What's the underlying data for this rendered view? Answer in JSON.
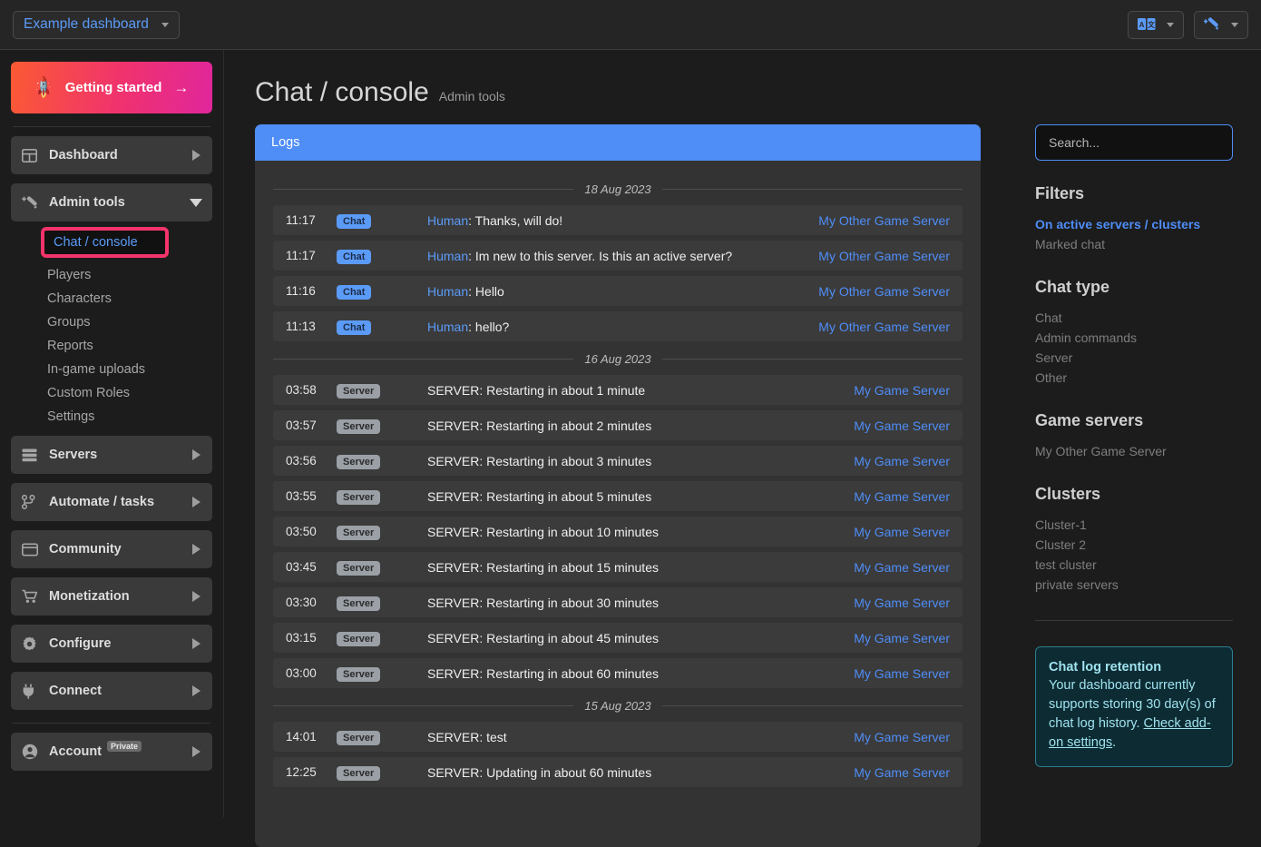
{
  "topbar": {
    "dashboard_name": "Example dashboard",
    "translate_icon": "translate-icon",
    "magic_icon": "magic-wand-icon"
  },
  "sidebar": {
    "getting_started": "Getting started",
    "rocket_icon": "rocket-icon",
    "arrow_icon": "arrow-right-icon",
    "items": [
      {
        "label": "Dashboard",
        "icon": "grid-icon",
        "expanded": false
      },
      {
        "label": "Admin tools",
        "icon": "magic-wand-icon",
        "expanded": true
      },
      {
        "label": "Servers",
        "icon": "server-stack-icon",
        "expanded": false
      },
      {
        "label": "Automate / tasks",
        "icon": "branch-icon",
        "expanded": false
      },
      {
        "label": "Community",
        "icon": "window-icon",
        "expanded": false
      },
      {
        "label": "Monetization",
        "icon": "cart-icon",
        "expanded": false
      },
      {
        "label": "Configure",
        "icon": "gear-icon",
        "expanded": false
      },
      {
        "label": "Connect",
        "icon": "plug-icon",
        "expanded": false
      },
      {
        "label": "Account",
        "icon": "user-circle-icon",
        "badge": "Private",
        "expanded": false
      }
    ],
    "admin_tools_sub": [
      "Chat / console",
      "Players",
      "Characters",
      "Groups",
      "Reports",
      "In-game uploads",
      "Custom Roles",
      "Settings"
    ],
    "active_sub": "Chat / console",
    "highlight_color": "#f4336b"
  },
  "page": {
    "title": "Chat / console",
    "subtitle": "Admin tools"
  },
  "logs": {
    "panel_title": "Logs",
    "header_color": "#4f8df7",
    "groups": [
      {
        "date": "18 Aug 2023",
        "rows": [
          {
            "time": "11:17",
            "type": "Chat",
            "who": "Human",
            "message": ": Thanks, will do!",
            "server": "My Other Game Server"
          },
          {
            "time": "11:17",
            "type": "Chat",
            "who": "Human",
            "message": ": Im new to this server. Is this an active server?",
            "server": "My Other Game Server"
          },
          {
            "time": "11:16",
            "type": "Chat",
            "who": "Human",
            "message": ": Hello",
            "server": "My Other Game Server"
          },
          {
            "time": "11:13",
            "type": "Chat",
            "who": "Human",
            "message": ": hello?",
            "server": "My Other Game Server"
          }
        ]
      },
      {
        "date": "16 Aug 2023",
        "rows": [
          {
            "time": "03:58",
            "type": "Server",
            "who": "",
            "message": "SERVER: Restarting in about 1 minute",
            "server": "My Game Server"
          },
          {
            "time": "03:57",
            "type": "Server",
            "who": "",
            "message": "SERVER: Restarting in about 2 minutes",
            "server": "My Game Server"
          },
          {
            "time": "03:56",
            "type": "Server",
            "who": "",
            "message": "SERVER: Restarting in about 3 minutes",
            "server": "My Game Server"
          },
          {
            "time": "03:55",
            "type": "Server",
            "who": "",
            "message": "SERVER: Restarting in about 5 minutes",
            "server": "My Game Server"
          },
          {
            "time": "03:50",
            "type": "Server",
            "who": "",
            "message": "SERVER: Restarting in about 10 minutes",
            "server": "My Game Server"
          },
          {
            "time": "03:45",
            "type": "Server",
            "who": "",
            "message": "SERVER: Restarting in about 15 minutes",
            "server": "My Game Server"
          },
          {
            "time": "03:30",
            "type": "Server",
            "who": "",
            "message": "SERVER: Restarting in about 30 minutes",
            "server": "My Game Server"
          },
          {
            "time": "03:15",
            "type": "Server",
            "who": "",
            "message": "SERVER: Restarting in about 45 minutes",
            "server": "My Game Server"
          },
          {
            "time": "03:00",
            "type": "Server",
            "who": "",
            "message": "SERVER: Restarting in about 60 minutes",
            "server": "My Game Server"
          }
        ]
      },
      {
        "date": "15 Aug 2023",
        "rows": [
          {
            "time": "14:01",
            "type": "Server",
            "who": "",
            "message": "SERVER: test",
            "server": "My Game Server"
          },
          {
            "time": "12:25",
            "type": "Server",
            "who": "",
            "message": "SERVER: Updating in about 60 minutes",
            "server": "My Game Server"
          }
        ]
      }
    ]
  },
  "rail": {
    "search_placeholder": "Search...",
    "filters_title": "Filters",
    "filters": [
      {
        "label": "On active servers / clusters",
        "active": true
      },
      {
        "label": "Marked chat",
        "active": false
      }
    ],
    "chat_type_title": "Chat type",
    "chat_types": [
      {
        "label": "Chat",
        "active": false
      },
      {
        "label": "Admin commands",
        "active": false
      },
      {
        "label": "Server",
        "active": false
      },
      {
        "label": "Other",
        "active": false
      }
    ],
    "game_servers_title": "Game servers",
    "game_servers": [
      {
        "label": "My Other Game Server",
        "active": false
      }
    ],
    "clusters_title": "Clusters",
    "clusters": [
      {
        "label": "Cluster-1",
        "active": false
      },
      {
        "label": "Cluster 2",
        "active": false
      },
      {
        "label": "test cluster",
        "active": false
      },
      {
        "label": "private servers",
        "active": false
      }
    ],
    "callout": {
      "title": "Chat log retention",
      "body_before": "Your dashboard currently supports storing 30 day(s) of chat log history. ",
      "link": "Check add-on settings",
      "body_after": "."
    }
  }
}
